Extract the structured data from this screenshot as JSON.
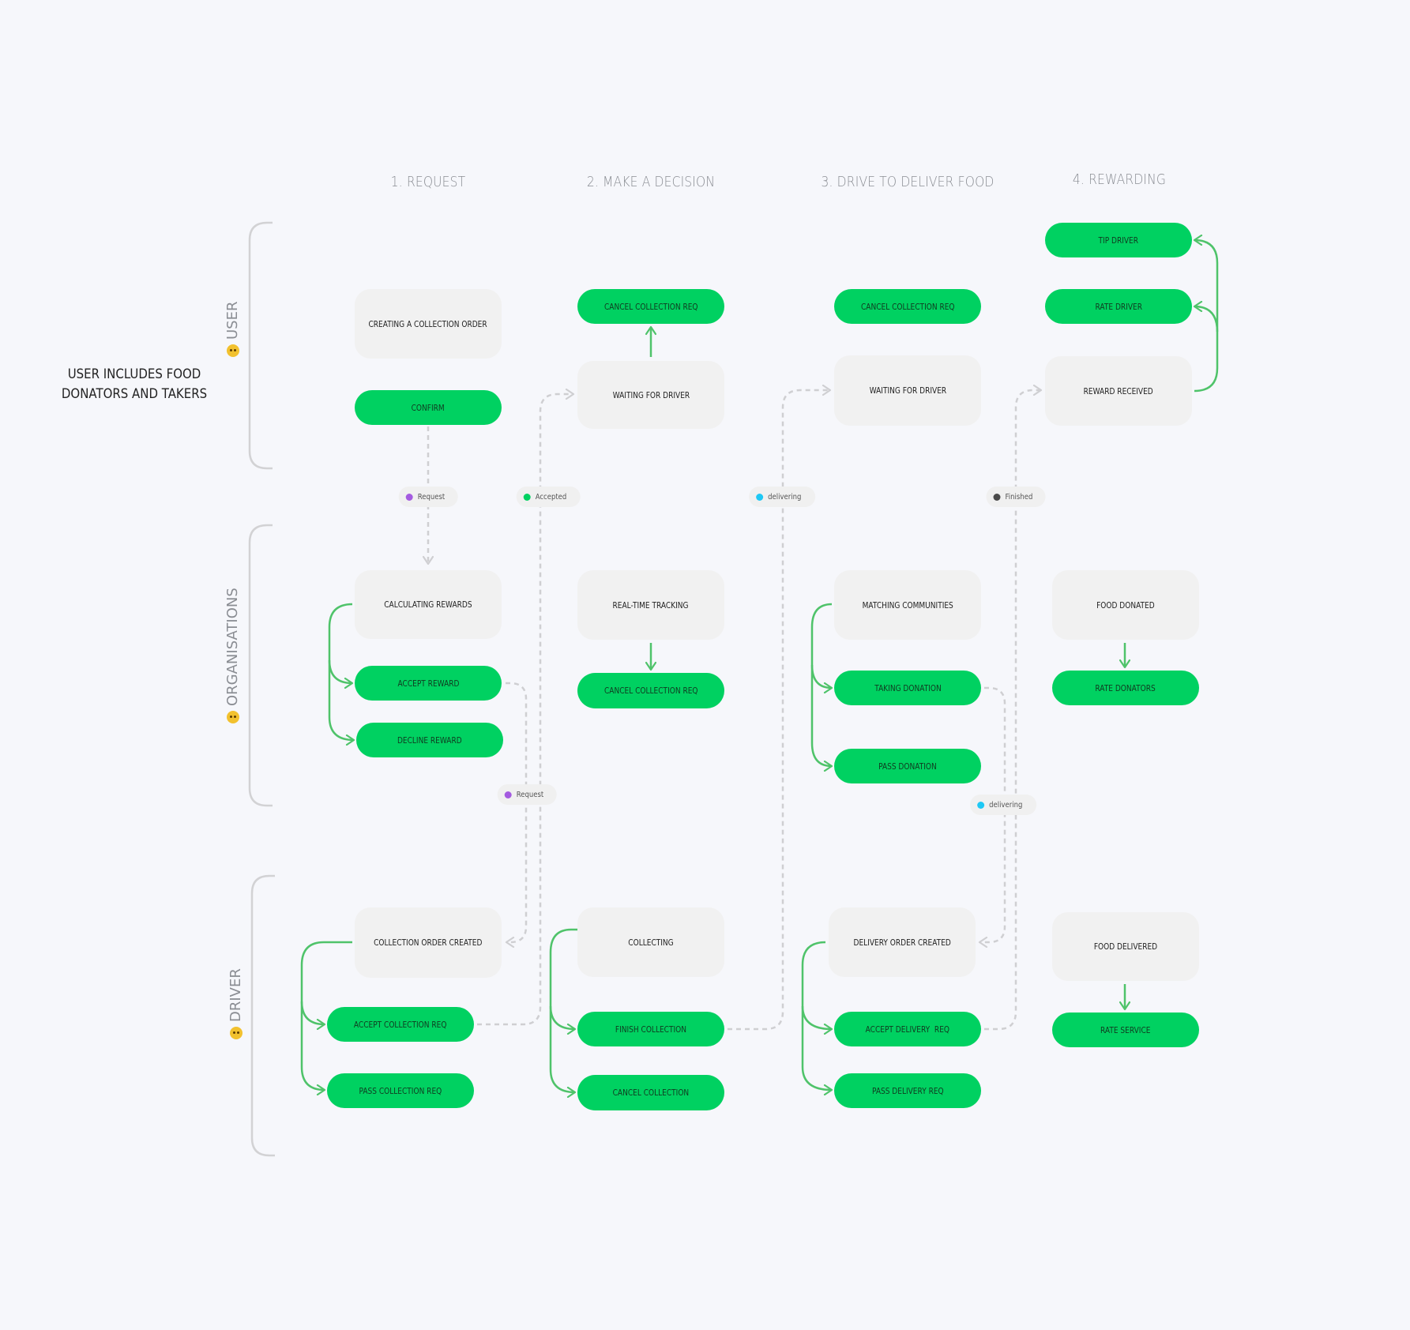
{
  "headers": [
    "1. REQUEST",
    "2. MAKE A DECISION",
    "3. DRIVE TO DELIVER FOOD",
    "4. REWARDING"
  ],
  "note": "USER INCLUDES FOOD DONATORS AND TAKERS",
  "lanes": {
    "user": {
      "label": "USER",
      "icon": "neutral-face-emoji-icon"
    },
    "organisations": {
      "label": "ORGANISATIONS",
      "icon": "person-emoji-icon"
    },
    "driver": {
      "label": "DRIVER",
      "icon": "person-emoji-icon"
    }
  },
  "nodes": {
    "creating_order": "CREATING A COLLECTION ORDER",
    "confirm": "CONFIRM",
    "cancel_collection_req_2": "CANCEL COLLECTION REQ",
    "waiting_for_driver_2": "WAITING FOR DRIVER",
    "cancel_collection_req_3": "CANCEL COLLECTION REQ",
    "waiting_for_driver_3": "WAITING FOR DRIVER",
    "tip_driver": "TIP DRIVER",
    "rate_driver": "RATE DRIVER",
    "reward_received": "REWARD RECEIVED",
    "calculating_rewards": "CALCULATING REWARDS",
    "accept_reward": "ACCEPT REWARD",
    "decline_reward": "DECLINE REWARD",
    "realtime_tracking": "REAL-TIME TRACKING",
    "cancel_collection_req_org": "CANCEL COLLECTION REQ",
    "matching_communities": "MATCHING COMMUNITIES",
    "taking_donation": "TAKING DONATION",
    "pass_donation": "PASS DONATION",
    "food_donated": "FOOD DONATED",
    "rate_donators": "RATE DONATORS",
    "collection_order_created": "COLLECTION ORDER CREATED",
    "accept_collection_req": "ACCEPT COLLECTION REQ",
    "pass_collection_req": "PASS COLLECTION REQ",
    "collecting": "COLLECTING",
    "finish_collection": "FINISH COLLECTION",
    "cancel_collection": "CANCEL COLLECTION",
    "delivery_order_created": "DELIVERY ORDER CREATED",
    "accept_delivery_req": "ACCEPT DELIVERY  REQ",
    "pass_delivery_req": "PASS DELIVERY REQ",
    "food_delivered": "FOOD DELIVERED",
    "rate_service": "RATE SERVICE"
  },
  "status_chips": {
    "request_1": {
      "label": "Request",
      "color": "#a45be0"
    },
    "accepted": {
      "label": "Accepted",
      "color": "#00d161"
    },
    "delivering_1": {
      "label": "delivering",
      "color": "#1ec8f5"
    },
    "finished": {
      "label": "Finished",
      "color": "#4a4a4a"
    },
    "request_2": {
      "label": "Request",
      "color": "#a45be0"
    },
    "delivering_2": {
      "label": "delivering",
      "color": "#1ec8f5"
    }
  },
  "colors": {
    "action_green": "#00d161",
    "arrow_green": "#4fc36a",
    "state_gray": "#f1f1f1",
    "dashed_gray": "#cfcfd2",
    "background": "#f6f7fb"
  }
}
